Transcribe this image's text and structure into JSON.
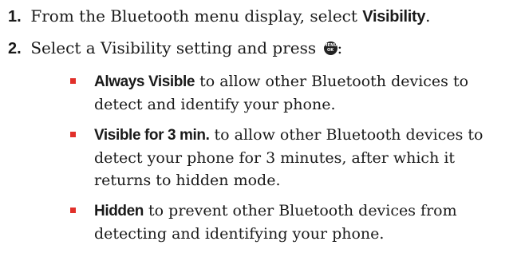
{
  "steps": [
    {
      "number": "1.",
      "text_before": "From the Bluetooth menu display, select ",
      "keyword": "Visibility",
      "text_after": "."
    },
    {
      "number": "2.",
      "text_before": "Select a Visibility setting and press ",
      "icon": "menu-ok-icon",
      "icon_text_top": "MENU",
      "icon_text_bottom": "OK",
      "text_after": ":"
    }
  ],
  "options": [
    {
      "keyword": "Always Visible",
      "description": " to allow other Bluetooth devices to detect and identify your phone."
    },
    {
      "keyword": "Visible for 3 min.",
      "description": " to allow other Bluetooth devices to detect your phone for 3 minutes, after which it returns to hidden mode."
    },
    {
      "keyword": "Hidden",
      "description": " to prevent other Bluetooth devices from detecting and identifying your phone."
    }
  ],
  "colors": {
    "bullet": "#e1302a",
    "text": "#1a1a1a"
  }
}
